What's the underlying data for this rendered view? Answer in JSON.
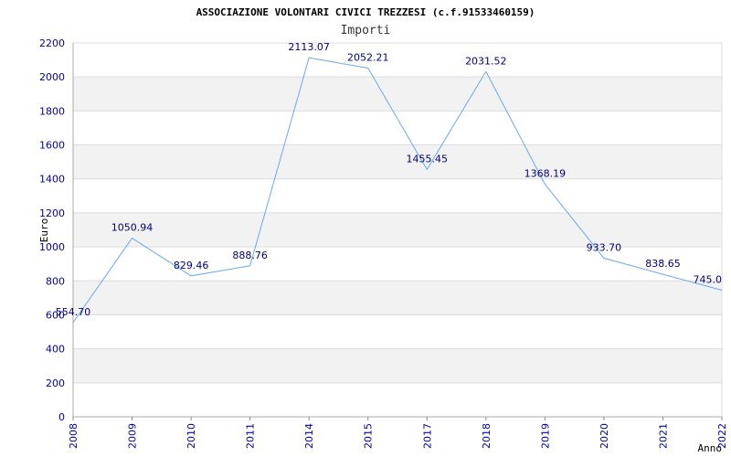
{
  "chart_data": {
    "type": "line",
    "title": "ASSOCIAZIONE VOLONTARI CIVICI TREZZESI (c.f.91533460159)",
    "subtitle": "Importi",
    "xlabel": "Anno",
    "ylabel": "Euro",
    "categories": [
      "2008",
      "2009",
      "2010",
      "2011",
      "2014",
      "2015",
      "2017",
      "2018",
      "2019",
      "2020",
      "2021",
      "2022"
    ],
    "values": [
      554.7,
      1050.94,
      829.46,
      888.76,
      2113.07,
      2052.21,
      1455.45,
      2031.52,
      1368.19,
      933.7,
      838.65,
      745.0
    ],
    "data_labels": [
      "554.70",
      "1050.94",
      "829.46",
      "888.76",
      "2113.07",
      "2052.21",
      "1455.45",
      "2031.52",
      "1368.19",
      "933.70",
      "838.65",
      "745.0"
    ],
    "y_ticks": [
      "0",
      "200",
      "400",
      "600",
      "800",
      "1000",
      "1200",
      "1400",
      "1600",
      "1800",
      "2000",
      "2200"
    ],
    "ylim": [
      0,
      2200
    ],
    "grid": true,
    "colors": {
      "line": "#6aa9ea",
      "label_text": "#000080",
      "tick_text": "#0000aa",
      "band_light": "#f2f2f2",
      "band_white": "#ffffff",
      "axis": "#666666"
    }
  }
}
